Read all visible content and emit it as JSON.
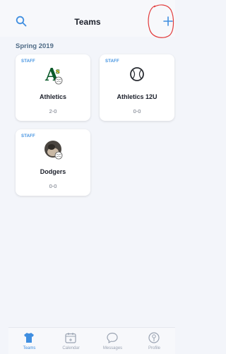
{
  "header": {
    "title": "Teams"
  },
  "section": {
    "label": "Spring 2019"
  },
  "teams": [
    {
      "badge": "STAFF",
      "name": "Athletics",
      "record": "2-0"
    },
    {
      "badge": "STAFF",
      "name": "Athletics 12U",
      "record": "0-0"
    },
    {
      "badge": "STAFF",
      "name": "Dodgers",
      "record": "0-0"
    }
  ],
  "tabs": [
    {
      "label": "Teams",
      "icon": "jersey-icon",
      "active": true
    },
    {
      "label": "Calendar",
      "icon": "calendar-icon",
      "active": false
    },
    {
      "label": "Messages",
      "icon": "chat-bubble-icon",
      "active": false
    },
    {
      "label": "Profile",
      "icon": "profile-icon",
      "active": false
    }
  ],
  "colors": {
    "accent": "#3f8ee0",
    "annotation": "#e23b3b",
    "background": "#f3f5fa"
  }
}
